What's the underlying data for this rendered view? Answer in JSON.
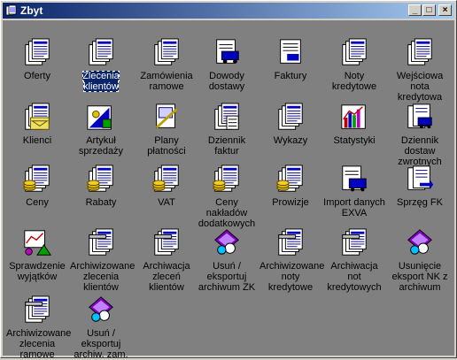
{
  "window": {
    "title": "Zbyt",
    "minimize": "_",
    "maximize": "□",
    "close": "×"
  },
  "icons": [
    {
      "label": "Oferty",
      "icon": "documents-stack-icon"
    },
    {
      "label": "Zlecenia klientów",
      "icon": "documents-stack-icon",
      "selected": true
    },
    {
      "label": "Zamówienia ramowe",
      "icon": "documents-stack-icon"
    },
    {
      "label": "Dowody dostawy",
      "icon": "delivery-document-icon"
    },
    {
      "label": "Faktury",
      "icon": "invoice-document-icon"
    },
    {
      "label": "Noty kredytowe",
      "icon": "documents-stack-icon"
    },
    {
      "label": "Wejściowa nota kredytowa",
      "icon": "documents-stack-icon"
    },
    {
      "label": "Klienci",
      "icon": "customer-folders-icon"
    },
    {
      "label": "Artykuł sprzedaży",
      "icon": "sale-article-icon"
    },
    {
      "label": "Plany płatności",
      "icon": "payment-plan-icon"
    },
    {
      "label": "Dziennik faktur",
      "icon": "invoice-journal-icon"
    },
    {
      "label": "Wykazy",
      "icon": "documents-stack-icon"
    },
    {
      "label": "Statystyki",
      "icon": "statistics-chart-icon"
    },
    {
      "label": "Dziennik dostaw zwrotnych",
      "icon": "return-delivery-journal-icon"
    },
    {
      "label": "Ceny",
      "icon": "prices-coins-icon"
    },
    {
      "label": "Rabaty",
      "icon": "discounts-coins-icon"
    },
    {
      "label": "VAT",
      "icon": "vat-coins-icon"
    },
    {
      "label": "Ceny nakładów dodatkowych",
      "icon": "additional-costs-icon"
    },
    {
      "label": "Prowizje",
      "icon": "commission-coins-icon"
    },
    {
      "label": "Import danych EXVA",
      "icon": "import-data-icon"
    },
    {
      "label": "Sprzęg FK",
      "icon": "fk-link-icon"
    },
    {
      "label": "Sprawdzenie wyjątków",
      "icon": "exceptions-check-icon"
    },
    {
      "label": "Archiwizowane zlecenia klientów",
      "icon": "archive-documents-icon"
    },
    {
      "label": "Archiwacja zleceń klientów",
      "icon": "archive-documents-icon"
    },
    {
      "label": "Usuń / eksportuj archiwum ZK",
      "icon": "export-archive-icon"
    },
    {
      "label": "Archiwizowane noty kredytowe",
      "icon": "archive-documents-icon"
    },
    {
      "label": "Archiwacja not kredytowych",
      "icon": "archive-documents-icon"
    },
    {
      "label": "Usunięcie eksport NK z archiwum",
      "icon": "export-archive-icon"
    },
    {
      "label": "Archiwizowane zlecenia ramowe",
      "icon": "archive-documents-icon"
    },
    {
      "label": "Usuń / eksportuj archiw. zam.",
      "icon": "export-archive-icon"
    }
  ]
}
